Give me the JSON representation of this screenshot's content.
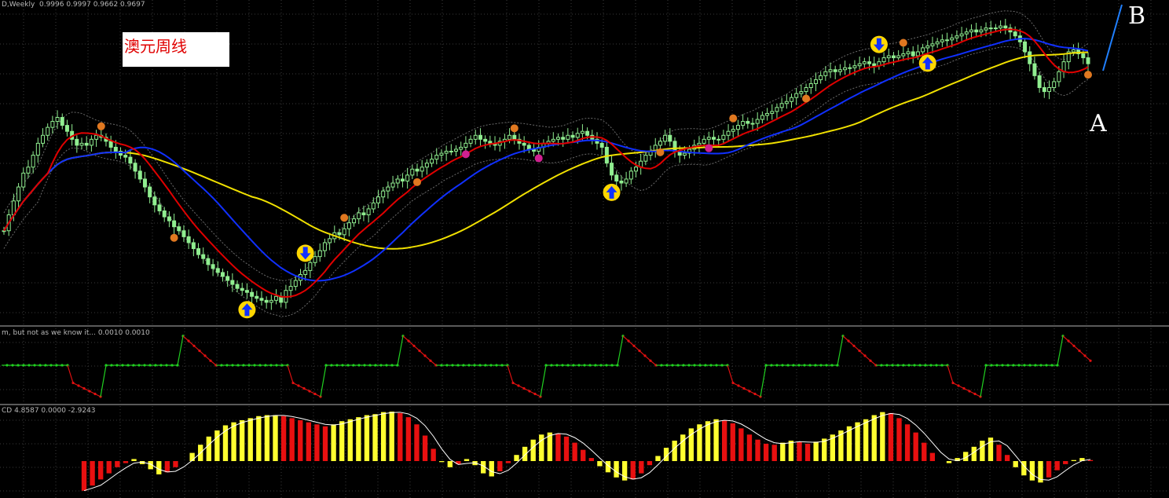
{
  "main_panel": {
    "header": "D,Weekly  0.9996 0.9997 0.9662 0.9697",
    "title_box": "澳元周线",
    "annotation_a": "A",
    "annotation_b": "B"
  },
  "indicator1": {
    "header": "m, but not as we know it... 0.0010 0.0010"
  },
  "indicator2": {
    "header": "CD 4.8587 0.0000 -2.9243"
  },
  "colors": {
    "background": "#000000",
    "grid": "#3a3a3a",
    "candle": "#90ee90",
    "ma_red": "#e00000",
    "ma_blue": "#1030ff",
    "ma_yellow": "#f0e000",
    "envelope": "#6a6a6a",
    "state_green": "#20d020",
    "state_red": "#e01010",
    "hist_yellow": "#ffff30",
    "hist_red": "#e81010",
    "signal_line": "#ffffff",
    "arrow_circle": "#ffd700",
    "arrow": "#1030ff",
    "dot_orange": "#e07820",
    "dot_magenta": "#d02090"
  },
  "chart_data": [
    {
      "type": "candlestick",
      "title": "澳元周线",
      "instrument_header": "D,Weekly",
      "last_ohlc": {
        "open": 0.9996,
        "high": 0.9997,
        "low": 0.9662,
        "close": 0.9697
      },
      "close": [
        0.4,
        0.48,
        0.55,
        0.62,
        0.69,
        0.72,
        0.78,
        0.84,
        0.88,
        0.92,
        0.95,
        0.97,
        0.93,
        0.9,
        0.86,
        0.83,
        0.84,
        0.83,
        0.86,
        0.88,
        0.87,
        0.85,
        0.82,
        0.8,
        0.78,
        0.77,
        0.74,
        0.7,
        0.66,
        0.62,
        0.57,
        0.53,
        0.5,
        0.47,
        0.45,
        0.42,
        0.4,
        0.37,
        0.34,
        0.31,
        0.28,
        0.26,
        0.23,
        0.21,
        0.19,
        0.17,
        0.15,
        0.13,
        0.11,
        0.1,
        0.09,
        0.07,
        0.06,
        0.05,
        0.04,
        0.05,
        0.07,
        0.04,
        0.1,
        0.12,
        0.15,
        0.18,
        0.2,
        0.24,
        0.27,
        0.3,
        0.34,
        0.36,
        0.39,
        0.38,
        0.41,
        0.44,
        0.46,
        0.49,
        0.48,
        0.51,
        0.54,
        0.57,
        0.6,
        0.62,
        0.64,
        0.66,
        0.65,
        0.68,
        0.71,
        0.7,
        0.72,
        0.74,
        0.76,
        0.78,
        0.79,
        0.8,
        0.8,
        0.81,
        0.82,
        0.84,
        0.86,
        0.88,
        0.86,
        0.85,
        0.84,
        0.83,
        0.85,
        0.86,
        0.88,
        0.86,
        0.84,
        0.83,
        0.81,
        0.8,
        0.82,
        0.84,
        0.85,
        0.86,
        0.87,
        0.86,
        0.88,
        0.87,
        0.89,
        0.9,
        0.88,
        0.86,
        0.84,
        0.82,
        0.74,
        0.68,
        0.65,
        0.64,
        0.66,
        0.7,
        0.72,
        0.75,
        0.78,
        0.8,
        0.83,
        0.85,
        0.88,
        0.85,
        0.8,
        0.78,
        0.79,
        0.81,
        0.83,
        0.84,
        0.86,
        0.87,
        0.86,
        0.86,
        0.88,
        0.9,
        0.91,
        0.93,
        0.95,
        0.94,
        0.94,
        0.96,
        0.98,
        0.99,
        1.0,
        1.02,
        1.04,
        1.05,
        1.07,
        1.09,
        1.1,
        1.12,
        1.14,
        1.16,
        1.18,
        1.2,
        1.21,
        1.2,
        1.21,
        1.22,
        1.22,
        1.23,
        1.24,
        1.25,
        1.24,
        1.23,
        1.25,
        1.27,
        1.28,
        1.27,
        1.28,
        1.29,
        1.3,
        1.28,
        1.3,
        1.32,
        1.33,
        1.34,
        1.35,
        1.36,
        1.36,
        1.37,
        1.38,
        1.39,
        1.4,
        1.41,
        1.4,
        1.41,
        1.42,
        1.42,
        1.42,
        1.43,
        1.42,
        1.4,
        1.38,
        1.35,
        1.3,
        1.24,
        1.18,
        1.12,
        1.1,
        1.12,
        1.15,
        1.2,
        1.25,
        1.3,
        1.31,
        1.29,
        1.27,
        1.24
      ],
      "moving_averages": [
        "red",
        "blue",
        "yellow"
      ],
      "envelope": "dotted upper/lower bands",
      "signals": [
        "arrow-up",
        "arrow-down",
        "orange-dot",
        "magenta-dot"
      ]
    },
    {
      "type": "step-oscillator",
      "header": "m, but not as we know it... 0.0010 0.0010",
      "values": [
        0.001,
        0.001
      ],
      "states": [
        "red",
        "green",
        "green",
        "green",
        "red",
        "green",
        "green",
        "red",
        "green",
        "green",
        "red",
        "green",
        "green",
        "green",
        "red",
        "green",
        "red",
        "green",
        "red",
        "green"
      ]
    },
    {
      "type": "histogram",
      "header": "CD 4.8587 0.0000 -2.9243",
      "values": [
        4.8587,
        0.0,
        -2.9243
      ],
      "series": [
        {
          "color": "yellow/red bars",
          "values": [
            -2.9,
            -2.4,
            -1.8,
            -1.2,
            -0.6,
            -0.2,
            0.2,
            -0.3,
            -0.8,
            -1.3,
            -1.1,
            -0.6,
            0.0,
            0.8,
            1.6,
            2.4,
            3.0,
            3.5,
            3.8,
            4.0,
            4.2,
            4.4,
            4.5,
            4.5,
            4.4,
            4.2,
            4.0,
            3.8,
            3.6,
            3.4,
            3.6,
            3.9,
            4.1,
            4.3,
            4.5,
            4.6,
            4.8,
            4.85,
            4.7,
            4.3,
            3.6,
            2.5,
            1.2,
            -0.1,
            -0.6,
            -0.3,
            0.2,
            -0.4,
            -1.2,
            -1.5,
            -1.0,
            -0.2,
            0.6,
            1.4,
            2.1,
            2.6,
            2.8,
            2.7,
            2.4,
            1.8,
            1.1,
            0.3,
            -0.5,
            -1.1,
            -1.6,
            -1.9,
            -1.8,
            -1.2,
            -0.4,
            0.5,
            1.3,
            2.0,
            2.6,
            3.2,
            3.6,
            3.9,
            4.1,
            4.0,
            3.7,
            3.2,
            2.6,
            2.1,
            1.7,
            1.6,
            1.8,
            2.0,
            1.9,
            1.7,
            1.9,
            2.2,
            2.6,
            3.0,
            3.4,
            3.8,
            4.1,
            4.5,
            4.8,
            4.7,
            4.2,
            3.6,
            2.8,
            1.8,
            0.8,
            0.0,
            -0.2,
            0.3,
            0.9,
            1.4,
            2.0,
            2.3,
            1.6,
            0.6,
            -0.6,
            -1.4,
            -1.9,
            -2.1,
            -1.6,
            -0.9,
            -0.3,
            0.1,
            0.3,
            0.1
          ]
        },
        {
          "color": "white signal line",
          "values": "smoothed histogram"
        }
      ]
    }
  ]
}
